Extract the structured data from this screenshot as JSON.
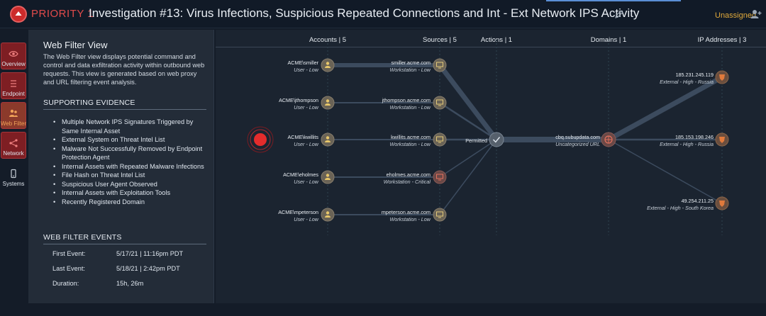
{
  "header": {
    "priority_label": "PRIORITY 1",
    "title": "Investigation #13: Virus Infections, Suspicious Repeated Connections and Int - Ext Network IPS Activity",
    "assignee": "Unassigned",
    "icons": [
      "priority-up-icon",
      "edit-pencil-icon",
      "assign-user-icon"
    ]
  },
  "sidebar": {
    "items": [
      {
        "label": "Overview",
        "icon": "eye-icon"
      },
      {
        "label": "Endpoint",
        "icon": "list-icon"
      },
      {
        "label": "Web Filter",
        "icon": "people-icon",
        "active": true
      },
      {
        "label": "Network",
        "icon": "network-icon"
      },
      {
        "label": "Systems",
        "icon": "device-icon"
      }
    ]
  },
  "info": {
    "title": "Web Filter View",
    "description": "The Web Filter view displays potential command and control and data exfiltration activity within outbound web requests. This view is generated based on web proxy and URL filtering event analysis.",
    "evidence_heading": "SUPPORTING EVIDENCE",
    "evidence": [
      "Multiple Network IPS Signatures Triggered by Same Internal Asset",
      "External System on Threat Intel List",
      "Malware Not Successfully Removed by Endpoint Protection Agent",
      "Internal Assets with Repeated Malware Infections",
      "File Hash on Threat Intel List",
      "Suspicious User Agent Observed",
      "Internal Assets with Exploitation Tools",
      "Recently Registered Domain"
    ],
    "events_heading": "WEB FILTER EVENTS",
    "events": [
      {
        "key": "First Event:",
        "value": "5/17/21 | 11:16pm PDT"
      },
      {
        "key": "Last Event:",
        "value": "5/18/21 | 2:42pm PDT"
      },
      {
        "key": "Duration:",
        "value": "15h, 26m"
      }
    ]
  },
  "graph": {
    "columns": [
      "Accounts | 5",
      "Sources | 5",
      "Actions | 1",
      "Domains | 1",
      "IP Addresses | 3"
    ],
    "accounts": [
      {
        "name": "ACME\\smiller",
        "sub": "User - Low"
      },
      {
        "name": "ACME\\jthompson",
        "sub": "User - Low"
      },
      {
        "name": "ACME\\kwillits",
        "sub": "User - Low"
      },
      {
        "name": "ACME\\eholmes",
        "sub": "User - Low"
      },
      {
        "name": "ACME\\mpeterson",
        "sub": "User - Low"
      }
    ],
    "sources": [
      {
        "name": "smiller.acme.com",
        "sub": "Workstation - Low",
        "critical": false
      },
      {
        "name": "jthompson.acme.com",
        "sub": "Workstation - Low",
        "critical": false
      },
      {
        "name": "kwillits.acme.com",
        "sub": "Workstation - Low",
        "critical": false
      },
      {
        "name": "eholmes.acme.com",
        "sub": "Workstation - Critical",
        "critical": true
      },
      {
        "name": "mpeterson.acme.com",
        "sub": "Workstation - Low",
        "critical": false
      }
    ],
    "action": {
      "name": "Permitted"
    },
    "domain": {
      "name": "cbq.subupdata.com",
      "sub": "Uncategorized URL"
    },
    "ips": [
      {
        "name": "185.231.245.119",
        "sub": "External - High - Russia"
      },
      {
        "name": "185.153.198.246",
        "sub": "External - High - Russia"
      },
      {
        "name": "49.254.211.25",
        "sub": "External - High - South Korea"
      }
    ]
  },
  "colors": {
    "accent_red": "#cc2b2b",
    "assignee_orange": "#e0a93b",
    "user_node": "#d9b85a",
    "workstation_node": "#c9b66a",
    "critical_node": "#c55a4b",
    "ip_node": "#e07a3c"
  }
}
